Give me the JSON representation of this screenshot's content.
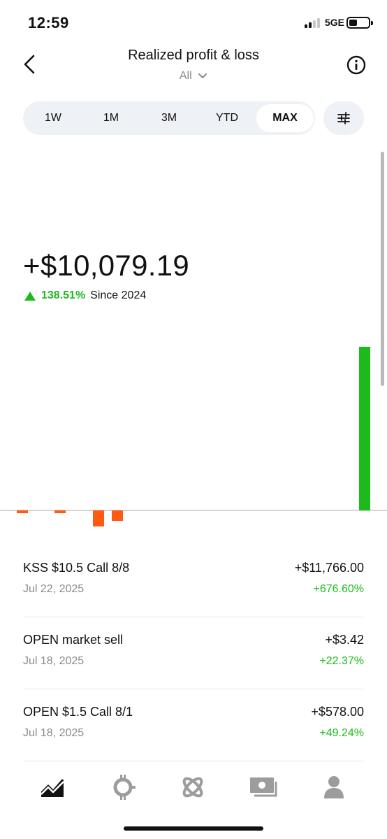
{
  "status_bar": {
    "time": "12:59",
    "network": "5GE"
  },
  "header": {
    "title": "Realized profit & loss",
    "filter_label": "All",
    "back_icon": "chevron-left-icon",
    "info_icon": "info-icon"
  },
  "range_tabs": [
    {
      "label": "1W",
      "active": false
    },
    {
      "label": "1M",
      "active": false
    },
    {
      "label": "3M",
      "active": false
    },
    {
      "label": "YTD",
      "active": false
    },
    {
      "label": "MAX",
      "active": true
    }
  ],
  "filter_button_icon": "sliders-icon",
  "summary": {
    "total": "+$10,079.19",
    "change_pct": "138.51%",
    "since": "Since 2024"
  },
  "colors": {
    "gain": "#1cbb1c",
    "loss": "#ff5a14",
    "tab_bg": "#eef1f6"
  },
  "chart_data": {
    "type": "bar",
    "note_values": "relative daily realized P&L bars; positive bar is 11766",
    "values": [
      -25,
      -25,
      -168,
      -100,
      11766
    ]
  },
  "transactions": [
    {
      "name": "KSS $10.5 Call 8/8",
      "date": "Jul 22, 2025",
      "amount": "+$11,766.00",
      "pct": "+676.60%"
    },
    {
      "name": "OPEN market sell",
      "date": "Jul 18, 2025",
      "amount": "+$3.42",
      "pct": "+22.37%"
    },
    {
      "name": "OPEN $1.5 Call 8/1",
      "date": "Jul 18, 2025",
      "amount": "+$578.00",
      "pct": "+49.24%"
    }
  ],
  "bottom_nav": [
    {
      "icon": "chart-icon",
      "active": true
    },
    {
      "icon": "crypto-icon",
      "active": false
    },
    {
      "icon": "atom-icon",
      "active": false
    },
    {
      "icon": "cash-icon",
      "active": false
    },
    {
      "icon": "profile-icon",
      "active": false
    }
  ]
}
